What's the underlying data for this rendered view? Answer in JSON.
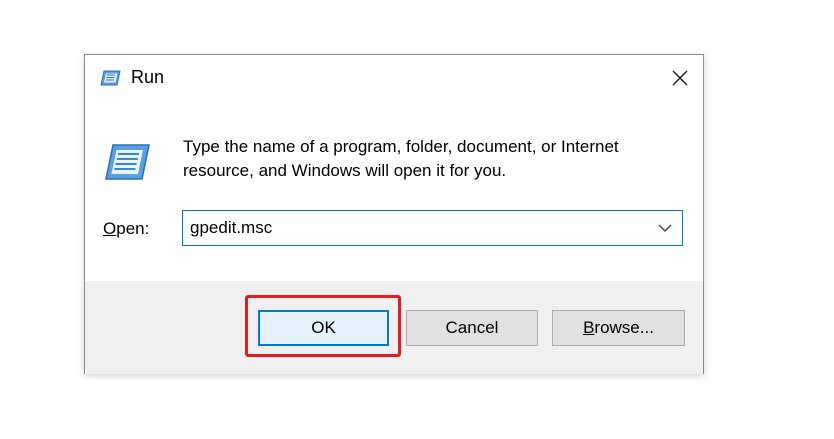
{
  "window": {
    "title": "Run",
    "title_icon": "run-icon",
    "close_icon": "close-icon"
  },
  "content": {
    "icon": "run-icon",
    "message_line1": "Type the name of a program, folder, document, or Internet",
    "message_line2": "resource, and Windows will open it for you.",
    "open_label_accel": "O",
    "open_label_rest": "pen:",
    "input_value": "gpedit.msc",
    "dropdown_icon": "chevron-down-icon"
  },
  "buttons": {
    "ok_label": "OK",
    "cancel_label": "Cancel",
    "browse_accel": "B",
    "browse_rest": "rowse..."
  },
  "colors": {
    "focus_blue": "#0078d7",
    "highlight_red": "#e02020",
    "footer_bg": "#f0f0f0",
    "button_bg": "#e1e1e1"
  }
}
